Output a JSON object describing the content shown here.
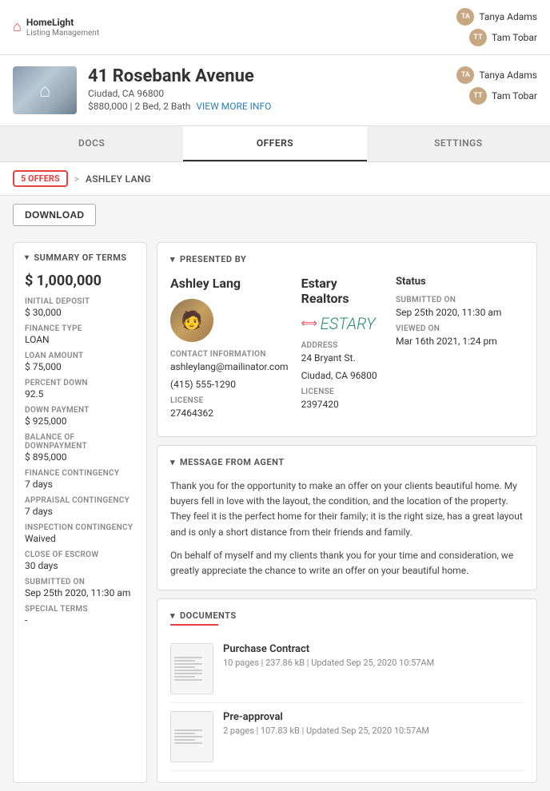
{
  "app": {
    "logo_name": "HomeLight",
    "logo_sub": "Listing Management"
  },
  "header": {
    "users": [
      {
        "name": "Tanya Adams",
        "initials": "TA"
      },
      {
        "name": "Tam Tobar",
        "initials": "TT"
      }
    ]
  },
  "property": {
    "address": "41 Rosebank Avenue",
    "city": "Ciudad, CA 96800",
    "details": "$880,000 | 2 Bed, 2 Bath",
    "view_more": "VIEW MORE INFO"
  },
  "tabs": [
    {
      "label": "DOCS",
      "active": false
    },
    {
      "label": "OFFERS",
      "active": true
    },
    {
      "label": "SETTINGS",
      "active": false
    }
  ],
  "breadcrumb": {
    "offers": "5 OFFERS",
    "separator": ">",
    "current": "ASHLEY LANG"
  },
  "toolbar": {
    "download_label": "DOWNLOAD"
  },
  "summary": {
    "title": "SUMMARY OF TERMS",
    "price": "$ 1,000,000",
    "terms": [
      {
        "label": "INITIAL DEPOSIT",
        "value": "$ 30,000"
      },
      {
        "label": "FINANCE TYPE",
        "value": "LOAN"
      },
      {
        "label": "LOAN AMOUNT",
        "value": "$ 75,000"
      },
      {
        "label": "PERCENT DOWN",
        "value": "92.5"
      },
      {
        "label": "DOWN PAYMENT",
        "value": "$ 925,000"
      },
      {
        "label": "BALANCE OF DOWNPAYMENT",
        "value": "$ 895,000"
      },
      {
        "label": "FINANCE CONTINGENCY",
        "value": "7 days"
      },
      {
        "label": "APPRAISAL CONTINGENCY",
        "value": "7 days"
      },
      {
        "label": "INSPECTION CONTINGENCY",
        "value": "Waived"
      },
      {
        "label": "CLOSE OF ESCROW",
        "value": "30 days"
      },
      {
        "label": "SUBMITTED ON",
        "value": "Sep 25th 2020, 11:30 am"
      },
      {
        "label": "SPECIAL TERMS",
        "value": "-"
      }
    ]
  },
  "presented_by": {
    "title": "PRESENTED BY",
    "agent": {
      "name": "Ashley Lang",
      "contact_label": "CONTACT INFORMATION",
      "email": "ashleylang@mailinator.com",
      "phone": "(415) 555-1290",
      "license_label": "LICENSE",
      "license": "27464362"
    },
    "brokerage": {
      "name": "Estary Realtors",
      "address_label": "ADDRESS",
      "address_line1": "24 Bryant St.",
      "address_line2": "Ciudad, CA 96800",
      "license_label": "LICENSE",
      "license": "2397420"
    },
    "status": {
      "title": "Status",
      "submitted_label": "SUBMITTED ON",
      "submitted": "Sep 25th 2020, 11:30 am",
      "viewed_label": "VIEWED ON",
      "viewed": "Mar 16th 2021, 1:24 pm"
    }
  },
  "message": {
    "title": "MESSAGE FROM AGENT",
    "text1": "Thank you for the opportunity to make an offer on your clients beautiful home. My buyers fell in love with the layout, the condition, and the location of the property. They feel it is the perfect home for their family; it is the right size, has a great layout and is only a short distance from their friends and family.",
    "text2": "On behalf of myself and my clients thank you for your time and consideration, we greatly appreciate the chance to write an offer on your beautiful home."
  },
  "documents": {
    "title": "DOCUMENTS",
    "items": [
      {
        "name": "Purchase Contract",
        "meta": "10 pages | 237.86 kB | Updated Sep 25, 2020 10:57AM"
      },
      {
        "name": "Pre-approval",
        "meta": "2 pages | 107.83 kB | Updated Sep 25, 2020 10:57AM"
      }
    ]
  }
}
